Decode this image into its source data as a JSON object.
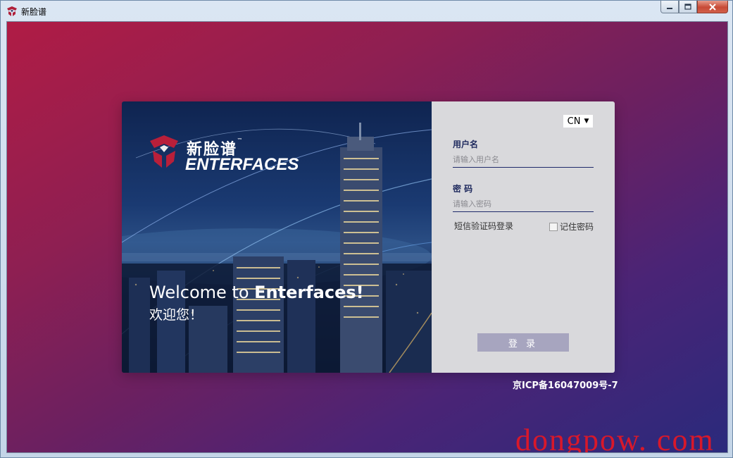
{
  "window": {
    "title": "新脸谱",
    "controls": [
      "minimize-icon",
      "maximize-icon",
      "close-icon"
    ]
  },
  "hero": {
    "logo_cn": "新脸谱",
    "logo_tm": "™",
    "logo_en": "ENTERFACES",
    "welcome_prefix": "Welcome to ",
    "welcome_brand": "Enterfaces!",
    "welcome_cn": "欢迎您！"
  },
  "login": {
    "language": "CN",
    "username_label": "用户名",
    "username_placeholder": "请输入用户名",
    "password_label": "密 码",
    "password_placeholder": "请输入密码",
    "sms_login": "短信验证码登录",
    "remember_password": "记住密码",
    "remember_checked": false,
    "submit": "登 录"
  },
  "footer": {
    "icp": "京ICP备16047009号-7"
  },
  "watermark": "dongpow. com",
  "colors": {
    "accent": "#1f2a5e",
    "button": "#a7a5bf",
    "bg_start": "#b01c45",
    "bg_end": "#2a2a7c"
  }
}
